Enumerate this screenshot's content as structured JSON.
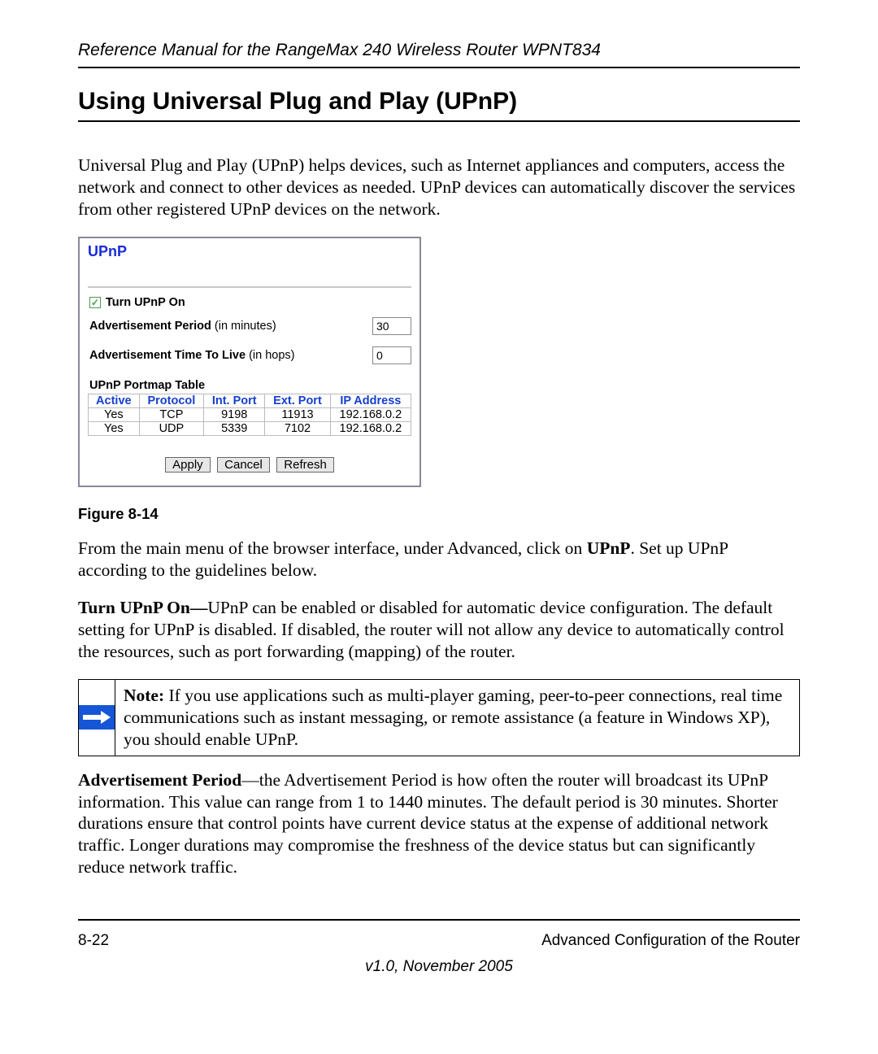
{
  "header": {
    "running_title": "Reference Manual for the RangeMax 240 Wireless Router WPNT834"
  },
  "section": {
    "title": "Using Universal Plug and Play (UPnP)"
  },
  "intro_paragraph": "Universal Plug and Play (UPnP) helps devices, such as Internet appliances and computers, access the network and connect to other devices as needed. UPnP devices can automatically discover the services from other registered UPnP devices on the network.",
  "figure": {
    "panel_title": "UPnP",
    "checkbox": {
      "checked": true,
      "label": "Turn UPnP On"
    },
    "settings": [
      {
        "label_bold": "Advertisement Period",
        "label_rest": " (in minutes)",
        "value": "30"
      },
      {
        "label_bold": "Advertisement Time To Live",
        "label_rest": " (in hops)",
        "value": "0"
      }
    ],
    "table_title": "UPnP Portmap Table",
    "table": {
      "headers": [
        "Active",
        "Protocol",
        "Int. Port",
        "Ext. Port",
        "IP Address"
      ],
      "rows": [
        [
          "Yes",
          "TCP",
          "9198",
          "11913",
          "192.168.0.2"
        ],
        [
          "Yes",
          "UDP",
          "5339",
          "7102",
          "192.168.0.2"
        ]
      ]
    },
    "buttons": [
      "Apply",
      "Cancel",
      "Refresh"
    ],
    "caption": "Figure 8-14"
  },
  "after_figure": {
    "p1_before": "From the main menu of the browser interface, under Advanced, click on ",
    "p1_bold": "UPnP",
    "p1_after": ". Set up UPnP according to the guidelines below.",
    "p2_bold": "Turn UPnP On—",
    "p2_rest": "UPnP can be enabled or disabled for automatic device configuration. The default setting for UPnP is disabled. If disabled, the router will not allow any device to automatically control the resources, such as port forwarding (mapping) of the router."
  },
  "note": {
    "label": "Note:",
    "text": " If you use applications such as multi-player gaming, peer-to-peer connections, real time communications such as instant messaging, or remote assistance (a feature in Windows XP), you should enable UPnP."
  },
  "adv_period": {
    "bold": "Advertisement Period",
    "rest": "—the Advertisement Period is how often the router will broadcast its UPnP information. This value can range from 1 to 1440 minutes. The default period is 30 minutes. Shorter durations ensure that control points have current device status at the expense of additional network traffic. Longer durations may compromise the freshness of the device status but can significantly reduce network traffic."
  },
  "footer": {
    "page_number": "8-22",
    "chapter": "Advanced Configuration of the Router",
    "version": "v1.0, November 2005"
  }
}
